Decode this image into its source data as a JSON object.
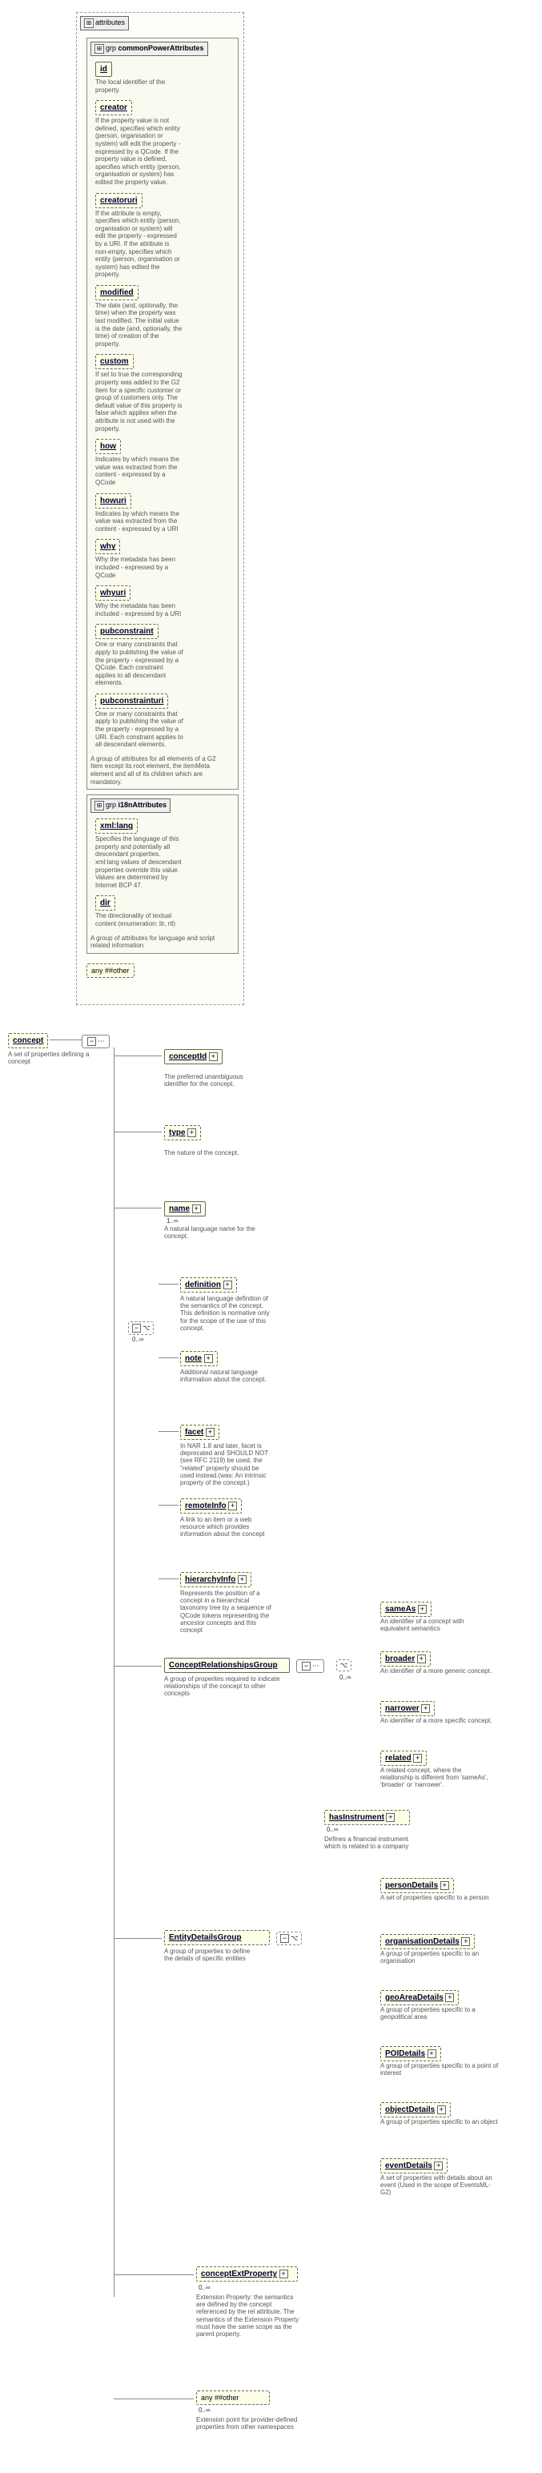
{
  "root": {
    "label": "concept",
    "desc": "A set of properties defining a concept",
    "card": ""
  },
  "attributes_hdr": "attributes",
  "common_power": {
    "label": "commonPowerAttributes",
    "desc": "A group of attributes for all elements of a G2 Item except its root element, the itemMeta element and all of its children which are mandatory."
  },
  "cpa": [
    {
      "name": "id",
      "kind": "solid",
      "desc": "The local identifier of the property."
    },
    {
      "name": "creator",
      "kind": "dashed",
      "desc": "If the property value is not defined, specifies which entity (person, organisation or system) will edit the property - expressed by a QCode. If the property value is defined, specifies which entity (person, organisation or system) has edited the property value."
    },
    {
      "name": "creatoruri",
      "kind": "dashed",
      "desc": "If the attribute is empty, specifies which entity (person, organisation or system) will edit the property - expressed by a URI. If the attribute is non-empty, specifies which entity (person, organisation or system) has edited the property."
    },
    {
      "name": "modified",
      "kind": "dashed",
      "desc": "The date (and, optionally, the time) when the property was last modified. The initial value is the date (and, optionally, the time) of creation of the property."
    },
    {
      "name": "custom",
      "kind": "dashed",
      "desc": "If set to true the corresponding property was added to the G2 Item for a specific customer or group of customers only. The default value of this property is false which applies when the attribute is not used with the property."
    },
    {
      "name": "how",
      "kind": "dashed",
      "desc": "Indicates by which means the value was extracted from the content - expressed by a QCode"
    },
    {
      "name": "howuri",
      "kind": "dashed",
      "desc": "Indicates by which means the value was extracted from the content - expressed by a URI"
    },
    {
      "name": "why",
      "kind": "dashed",
      "desc": "Why the metadata has been included - expressed by a QCode"
    },
    {
      "name": "whyuri",
      "kind": "dashed",
      "desc": "Why the metadata has been included - expressed by a URI"
    },
    {
      "name": "pubconstraint",
      "kind": "dashed",
      "desc": "One or many constraints that apply to publishing the value of the property - expressed by a QCode. Each constraint applies to all descendant elements."
    },
    {
      "name": "pubconstrainturi",
      "kind": "dashed",
      "desc": "One or many constraints that apply to publishing the value of the property - expressed by a URI. Each constraint applies to all descendant elements."
    }
  ],
  "i18n": {
    "label": "i18nAttributes",
    "desc": "A group of attributes for language and script related information"
  },
  "i18n_attrs": [
    {
      "name": "xml:lang",
      "kind": "dashed",
      "desc": "Specifies the language of this property and potentially all descendant properties. xml:lang values of descendant properties override this value. Values are determined by Internet BCP 47."
    },
    {
      "name": "dir",
      "kind": "dashed",
      "desc": "The directionality of textual content (enumeration: ltr, rtl)"
    }
  ],
  "any_other": "any ##other",
  "seq_children": [
    {
      "name": "conceptId",
      "kind": "solid",
      "desc": "The preferred unambiguous identifier for the concept."
    },
    {
      "name": "type",
      "kind": "dashed",
      "desc": "The nature of the concept."
    },
    {
      "name": "name",
      "kind": "solid",
      "card": "1..∞",
      "desc": "A natural language name for the concept."
    },
    {
      "name": "definition",
      "kind": "dashed",
      "desc": "A natural language definition of the semantics of the concept. This definition is normative only for the scope of the use of this concept."
    },
    {
      "name": "note",
      "kind": "dashed",
      "desc": "Additional natural language information about the concept."
    },
    {
      "name": "facet",
      "kind": "dashed",
      "desc": "In NAR 1.8 and later, facet is deprecated and SHOULD NOT (see RFC 2119) be used, the \"related\" property should be used instead.(was: An intrinsic property of the concept.)"
    },
    {
      "name": "remoteInfo",
      "kind": "dashed",
      "desc": "A link to an item or a web resource which provides information about the concept"
    },
    {
      "name": "hierarchyInfo",
      "kind": "dashed",
      "desc": "Represents the position of a concept in a hierarchical taxonomy tree by a sequence of QCode tokens representing the ancestor concepts and this concept"
    }
  ],
  "choice_card": "0..∞",
  "crg": {
    "label": "ConceptRelationshipsGroup",
    "desc": "A group of properites required to indicate relationships of the concept to other concepts"
  },
  "crg_children": [
    {
      "name": "sameAs",
      "desc": "An identifier of a concept with equivalent semantics"
    },
    {
      "name": "broader",
      "desc": "An identifier of a more generic concept."
    },
    {
      "name": "narrower",
      "desc": "An identifier of a more specific concept."
    },
    {
      "name": "related",
      "desc": "A related concept, where the relationship is different from 'sameAs', 'broader' or 'narrower'."
    }
  ],
  "crg_card": "0..∞",
  "edg": {
    "label": "EntityDetailsGroup",
    "desc": "A group of properties to define the details of specific entities"
  },
  "hasInstrument": {
    "label": "hasInstrument",
    "card": "0..∞",
    "desc": "Defines a financial instrument which is related to a company"
  },
  "edg_children": [
    {
      "name": "personDetails",
      "desc": "A set of properties specific to a person"
    },
    {
      "name": "organisationDetails",
      "desc": "A group of properties specific to an organisation"
    },
    {
      "name": "geoAreaDetails",
      "desc": "A group of properties specific to a geopolitical area"
    },
    {
      "name": "POIDetails",
      "desc": "A group of properties specific to a point of interest"
    },
    {
      "name": "objectDetails",
      "desc": "A group of properties specific to an object"
    },
    {
      "name": "eventDetails",
      "desc": "A set of properties with details about an event (Used in the scope of EventsML-G2)"
    }
  ],
  "cep": {
    "label": "conceptExtProperty",
    "card": "0..∞",
    "desc": "Extension Property: the semantics are defined by the concept referenced by the rel attribute. The semantics of the Extension Property must have the same scope as the parent property."
  },
  "ext": {
    "label": "any ##other",
    "card": "0..∞",
    "desc": "Extension point for provider-defined properties from other namespaces"
  }
}
